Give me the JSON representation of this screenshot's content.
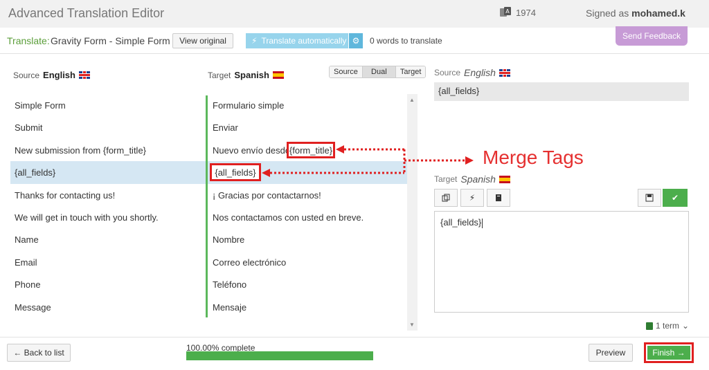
{
  "app": {
    "title": "Advanced Translation Editor",
    "counter": "1974",
    "signed_prefix": "Signed as ",
    "user": "mohamed.k"
  },
  "job": {
    "translate_label": "Translate:",
    "name": "Gravity Form - Simple Form",
    "view_original": "View original",
    "auto_label": "Translate automatically",
    "words_left": "0 words to translate",
    "feedback": "Send Feedback"
  },
  "columns": {
    "source_label": "Source",
    "source_lang": "English",
    "target_label": "Target",
    "target_lang": "Spanish"
  },
  "view_toggle": [
    "Source",
    "Dual",
    "Target"
  ],
  "rows": [
    {
      "source": "Simple Form",
      "target": "Formulario simple"
    },
    {
      "source": "Submit",
      "target": "Enviar"
    },
    {
      "source": "New submission from {form_title}",
      "target": "Nuevo envío desde"
    },
    {
      "source": "{all_fields}",
      "target": ""
    },
    {
      "source": "Thanks for contacting us!",
      "target": "¡ Gracias por contactarnos!"
    },
    {
      "source": "We will get in touch with you shortly.",
      "target": "Nos contactamos con usted en breve."
    },
    {
      "source": "Name",
      "target": "Nombre"
    },
    {
      "source": "Email",
      "target": "Correo electrónico"
    },
    {
      "source": "Phone",
      "target": "Teléfono"
    },
    {
      "source": "Message",
      "target": "Mensaje"
    }
  ],
  "merge_tags": {
    "label": "Merge Tags",
    "form_title": "{form_title}",
    "all_fields": "{all_fields}"
  },
  "detail": {
    "source_label": "Source",
    "source_lang": "English",
    "source_text": "{all_fields}",
    "target_label": "Target",
    "target_lang": "Spanish",
    "editor_text": "{all_fields}",
    "terms": "1 term"
  },
  "footer": {
    "back": "← Back to list",
    "progress_text": "100.00% complete",
    "progress": 1.0,
    "preview": "Preview",
    "finish": "Finish →"
  },
  "colors": {
    "green": "#4cae4c",
    "red": "#e02020",
    "blue": "#97d4ec",
    "purple": "#c79bd6"
  }
}
